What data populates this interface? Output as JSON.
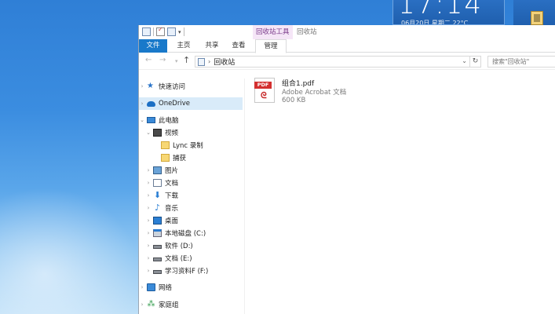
{
  "desktop": {
    "clock_time": "17:14",
    "clock_date": "06月20日  星期二  22°C"
  },
  "window": {
    "context_group": "回收站工具",
    "title": "回收站"
  },
  "ribbon": {
    "tabs": {
      "file": "文件",
      "home": "主页",
      "share": "共享",
      "view": "查看",
      "manage": "管理"
    }
  },
  "address": {
    "path_segment": "回收站",
    "search_placeholder": "搜索\"回收站\""
  },
  "nav_pane": {
    "items": [
      {
        "label": "快速访问"
      },
      {
        "label": "OneDrive"
      },
      {
        "label": "此电脑"
      },
      {
        "label": "视频"
      },
      {
        "label": "Lync 录制"
      },
      {
        "label": "捕获"
      },
      {
        "label": "图片"
      },
      {
        "label": "文档"
      },
      {
        "label": "下载"
      },
      {
        "label": "音乐"
      },
      {
        "label": "桌面"
      },
      {
        "label": "本地磁盘 (C:)"
      },
      {
        "label": "软件 (D:)"
      },
      {
        "label": "文档 (E:)"
      },
      {
        "label": "学习资料F (F:)"
      },
      {
        "label": "网络"
      },
      {
        "label": "家庭组"
      }
    ]
  },
  "files": [
    {
      "name": "组合1.pdf",
      "type": "Adobe Acrobat 文档",
      "size": "600 KB",
      "icon": "pdf-icon"
    }
  ],
  "colors": {
    "accent": "#1979ca",
    "selected_bg": "#d9ebf9",
    "context_tab_bg": "#f5e6f7"
  }
}
